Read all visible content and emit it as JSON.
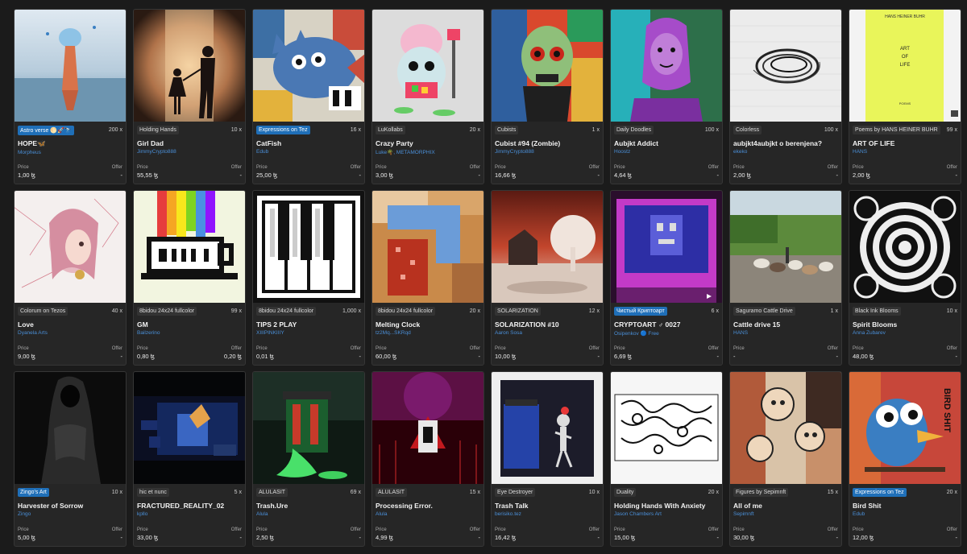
{
  "labels": {
    "price": "Price",
    "offer": "Offer"
  },
  "cards": [
    {
      "collection": "Astro verse 🌕🚀🔭",
      "collection_style": "blue",
      "editions": "200 x",
      "title": "HOPE🦋",
      "artist": "Morpheus",
      "price": "1,00 ꜩ",
      "offer": "-",
      "art": "hope"
    },
    {
      "collection": "Holding Hands",
      "collection_style": "plain",
      "editions": "10 x",
      "title": "Girl Dad",
      "artist": "JimmyCrypto888",
      "price": "55,55 ꜩ",
      "offer": "-",
      "art": "girldad"
    },
    {
      "collection": "Expressions on Tez",
      "collection_style": "blue",
      "editions": "16 x",
      "title": "CatFish",
      "artist": "Edub",
      "price": "25,00 ꜩ",
      "offer": "-",
      "art": "catfish"
    },
    {
      "collection": "LuKollabs",
      "collection_style": "plain",
      "editions": "20 x",
      "title": "Crazy Party",
      "artist": "Luke🌴, METAMORPHIX",
      "price": "3,00 ꜩ",
      "offer": "-",
      "art": "crazyparty"
    },
    {
      "collection": "Cubists",
      "collection_style": "plain",
      "editions": "1 x",
      "title": "Cubist #94 (Zombie)",
      "artist": "JimmyCrypto888",
      "price": "16,66 ꜩ",
      "offer": "-",
      "art": "zombie"
    },
    {
      "collection": "Daily Doodles",
      "collection_style": "plain",
      "editions": "100 x",
      "title": "Aubjkt Addict",
      "artist": "Hoostz",
      "price": "4,64 ꜩ",
      "offer": "-",
      "art": "aubjkt"
    },
    {
      "collection": "Colorless",
      "collection_style": "plain",
      "editions": "100 x",
      "title": "aubjkt4aubjkt o berenjena?",
      "artist": "ekeko",
      "price": "2,00 ꜩ",
      "offer": "-",
      "art": "scribble"
    },
    {
      "collection": "Poems by HANS HEINER BUHR",
      "collection_style": "plain",
      "editions": "99 x",
      "title": "ART OF LIFE",
      "artist": "HANS",
      "price": "2,00 ꜩ",
      "offer": "-",
      "art": "artoflife",
      "book_author": "HANS HEINER BUHR",
      "book_title": [
        "ART",
        "OF",
        "LIFE"
      ],
      "book_sub": "POEMS"
    },
    {
      "collection": "Colorum on Tezos",
      "collection_style": "plain",
      "editions": "40 x",
      "title": "Love",
      "artist": "Dyanela Arts",
      "price": "9,00 ꜩ",
      "offer": "-",
      "art": "love"
    },
    {
      "collection": "8bidou 24x24 fullcolor",
      "collection_style": "plain",
      "editions": "99 x",
      "title": "GM",
      "artist": "Bailzerino",
      "price": "0,80 ꜩ",
      "offer": "0,20 ꜩ",
      "art": "gm"
    },
    {
      "collection": "8bidou 24x24 fullcolor",
      "collection_style": "plain",
      "editions": "1,000 x",
      "title": "TIPS 2 PLAY",
      "artist": "XIIIPINKIIIY",
      "price": "0,01 ꜩ",
      "offer": "-",
      "art": "piano"
    },
    {
      "collection": "8bidou 24x24 fullcolor",
      "collection_style": "plain",
      "editions": "20 x",
      "title": "Melting Clock",
      "artist": "tz2Mq...SKRqd",
      "price": "60,00 ꜩ",
      "offer": "-",
      "art": "clock"
    },
    {
      "collection": "SOLARIZATION",
      "collection_style": "plain",
      "editions": "12 x",
      "title": "SOLARIZATION #10",
      "artist": "Aaron Sosa",
      "price": "10,00 ꜩ",
      "offer": "-",
      "art": "solar"
    },
    {
      "collection": "Чистый Криптоарт",
      "collection_style": "blue",
      "editions": "6 x",
      "title": "CRYPTOART ♂ 0027",
      "artist": "Osipenkov 🔵 Free",
      "price": "6,69 ꜩ",
      "offer": "-",
      "art": "cryptoart"
    },
    {
      "collection": "Saguramo Cattle Drive",
      "collection_style": "plain",
      "editions": "1 x",
      "title": "Cattle drive 15",
      "artist": "HANS",
      "price": "-",
      "offer": "-",
      "art": "cattle"
    },
    {
      "collection": "Black Ink Blooms",
      "collection_style": "plain",
      "editions": "10 x",
      "title": "Spirit Blooms",
      "artist": "Anna Zubarev",
      "price": "48,00 ꜩ",
      "offer": "-",
      "art": "blooms"
    },
    {
      "collection": "Zingo's Art",
      "collection_style": "blue",
      "editions": "10 x",
      "title": "Harvester of Sorrow",
      "artist": "Zingo",
      "price": "5,00 ꜩ",
      "offer": "-",
      "art": "reaper"
    },
    {
      "collection": "hic et nunc",
      "collection_style": "plain",
      "editions": "5 x",
      "title": "FRACTURED_REALITY_02",
      "artist": "kpllo",
      "price": "33,00 ꜩ",
      "offer": "-",
      "art": "fractured"
    },
    {
      "collection": "ALULASIT",
      "collection_style": "plain",
      "editions": "69 x",
      "title": "Trash.Ure",
      "artist": "Alula",
      "price": "2,50 ꜩ",
      "offer": "-",
      "art": "trash"
    },
    {
      "collection": "ALULASIT",
      "collection_style": "plain",
      "editions": "15 x",
      "title": "Processing Error.",
      "artist": "Alula",
      "price": "4,99 ꜩ",
      "offer": "-",
      "art": "processing"
    },
    {
      "collection": "Eye Destroyer",
      "collection_style": "plain",
      "editions": "10 x",
      "title": "Trash Talk",
      "artist": "berisiko.tez",
      "price": "16,42 ꜩ",
      "offer": "-",
      "art": "trashtalk"
    },
    {
      "collection": "Duality",
      "collection_style": "plain",
      "editions": "20 x",
      "title": "Holding Hands With Anxiety",
      "artist": "Jason Chambers Art",
      "price": "15,00 ꜩ",
      "offer": "-",
      "art": "anxiety"
    },
    {
      "collection": "Figures by Sepimnft",
      "collection_style": "plain",
      "editions": "15 x",
      "title": "All of me",
      "artist": "Sepimnft",
      "price": "30,00 ꜩ",
      "offer": "-",
      "art": "allofme"
    },
    {
      "collection": "Expressions on Tez",
      "collection_style": "blue",
      "editions": "20 x",
      "title": "Bird Shit",
      "artist": "Edub",
      "price": "12,00 ꜩ",
      "offer": "-",
      "art": "bird",
      "art_text": "BIRD SHIT"
    }
  ]
}
